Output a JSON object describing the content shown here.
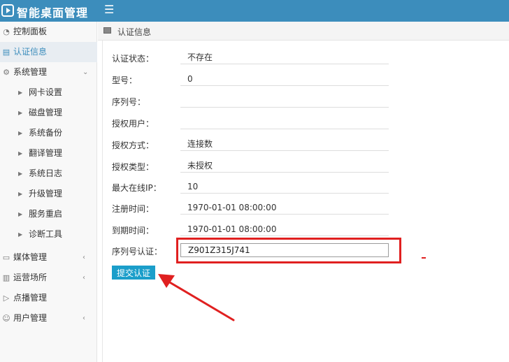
{
  "app": {
    "title": "智能桌面管理"
  },
  "sidebar": {
    "items": [
      {
        "label": "控制面板",
        "icon": "dashboard-icon",
        "has_children": false
      },
      {
        "label": "认证信息",
        "icon": "id-card-icon",
        "has_children": false,
        "active": true
      },
      {
        "label": "系统管理",
        "icon": "gear-icon",
        "has_children": true,
        "expanded": true,
        "children": [
          "网卡设置",
          "磁盘管理",
          "系统备份",
          "翻译管理",
          "系统日志",
          "升级管理",
          "服务重启",
          "诊断工具"
        ]
      },
      {
        "label": "媒体管理",
        "icon": "monitor-icon",
        "has_children": true
      },
      {
        "label": "运营场所",
        "icon": "building-icon",
        "has_children": true
      },
      {
        "label": "点播管理",
        "icon": "play-icon",
        "has_children": false
      },
      {
        "label": "用户管理",
        "icon": "user-icon",
        "has_children": true
      }
    ]
  },
  "breadcrumb": {
    "title": "认证信息",
    "icon": "id-card-icon"
  },
  "form": {
    "rows": [
      {
        "label": "认证状态：",
        "value": "不存在"
      },
      {
        "label": "型号：",
        "value": "0"
      },
      {
        "label": "序列号：",
        "value": ""
      },
      {
        "label": "授权用户：",
        "value": ""
      },
      {
        "label": "授权方式：",
        "value": "连接数"
      },
      {
        "label": "授权类型：",
        "value": "未授权"
      },
      {
        "label": "最大在线IP：",
        "value": "10"
      },
      {
        "label": "注册时间：",
        "value": "1970-01-01 08:00:00"
      },
      {
        "label": "到期时间：",
        "value": "1970-01-01 08:00:00"
      }
    ],
    "serial_label": "序列号认证：",
    "serial_value": "Z901Z315J741",
    "submit_label": "提交认证"
  },
  "colors": {
    "topbar": "#3c8dbc",
    "button": "#1b9eca",
    "annotation": "#e02020"
  }
}
